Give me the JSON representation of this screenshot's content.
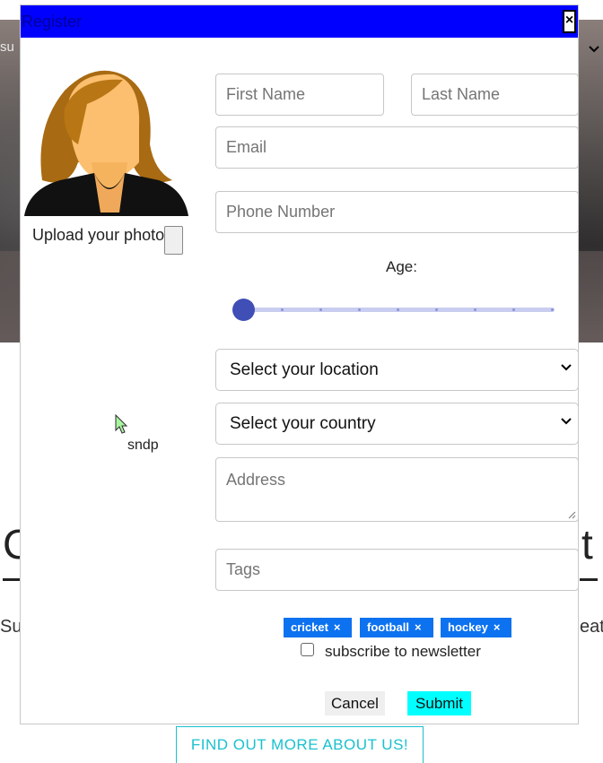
{
  "background": {
    "hero_text": "su",
    "heading_left": "C",
    "heading_right": "t",
    "text_left": "Su",
    "text_right": "eat",
    "button_label": "FIND OUT MORE ABOUT US!"
  },
  "modal": {
    "title": "Register",
    "close_label": "×",
    "upload_label": "Upload your photo",
    "caption": "sndp",
    "fields": {
      "first_name": "First Name",
      "last_name": "Last Name",
      "email": "Email",
      "phone": "Phone Number",
      "address": "Address",
      "tags": "Tags"
    },
    "age": {
      "label": "Age:",
      "value_fraction": 0.0
    },
    "location_select": "Select your location",
    "country_select": "Select your country",
    "tags": [
      "cricket",
      "football",
      "hockey"
    ],
    "tag_remove": "×",
    "newsletter_label": "subscribe to newsletter",
    "newsletter_checked": false,
    "cancel_label": "Cancel",
    "submit_label": "Submit"
  },
  "colors": {
    "titlebar": "#0000ff",
    "slider": "#3f4fb5",
    "tag": "#0d72ef",
    "submit": "#00ffff"
  }
}
